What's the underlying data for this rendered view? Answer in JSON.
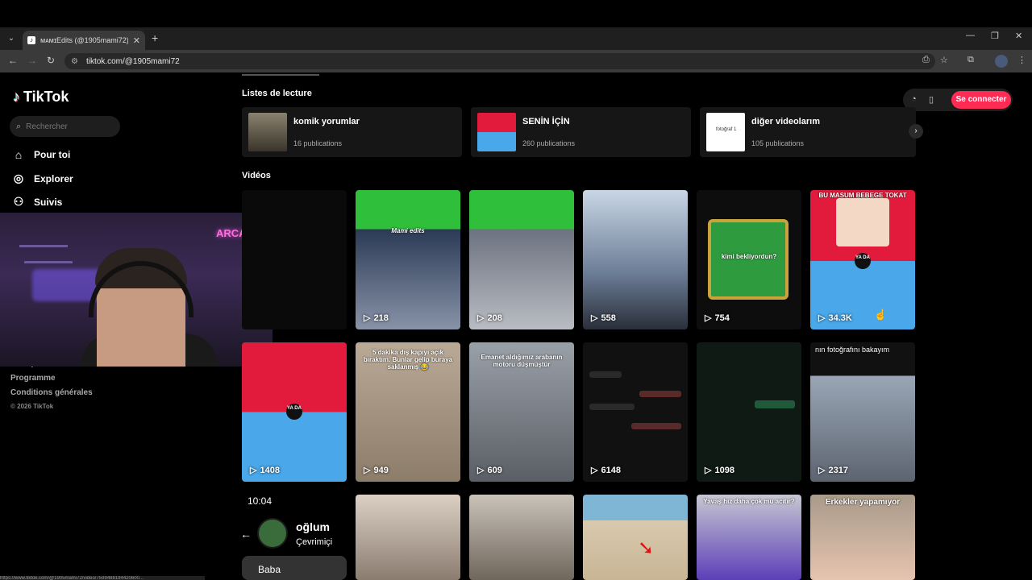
{
  "browser": {
    "tab_title": "ᴍᴀᴍɪEdits (@1905mami72) |",
    "tab_close": "✕",
    "new_tab": "+",
    "url": "tiktok.com/@1905mami72",
    "status_url": "https://www.tiktok.com/@1905mami72/video/7599488194420600..."
  },
  "sidebar": {
    "logo": "TikTok",
    "search_placeholder": "Rechercher",
    "nav": [
      {
        "label": "Pour toi",
        "icon": "compass-icon"
      },
      {
        "label": "Explorer",
        "icon": "explore-icon"
      },
      {
        "label": "Suivis",
        "icon": "following-icon"
      }
    ],
    "footer_links": [
      "Entreprise",
      "Programme",
      "Conditions générales"
    ],
    "copyright": "© 2026 TikTok"
  },
  "webcam": {
    "neon_sign": "ARCADE"
  },
  "header": {
    "connect_label": "Se connecter"
  },
  "playlists": {
    "title": "Listes de lecture",
    "items": [
      {
        "name": "komik yorumlar",
        "count": "16 publications"
      },
      {
        "name": "SENİN İÇİN",
        "count": "260 publications"
      },
      {
        "name": "diğer videolarım",
        "count": "105 publications",
        "thumb_text": "fotoğraf 1"
      }
    ]
  },
  "videos": {
    "title": "Vidéos",
    "row1": [
      {
        "views": "",
        "caption": ""
      },
      {
        "views": "218",
        "caption": "Mami edits"
      },
      {
        "views": "208",
        "caption": ""
      },
      {
        "views": "558",
        "caption": ""
      },
      {
        "views": "754",
        "caption": "kimi bekliyordun?"
      },
      {
        "views": "34.3K",
        "caption": "BU MASUM BEBEGE TOKAT AT",
        "badge": "YA DA"
      }
    ],
    "row2": [
      {
        "views": "1408",
        "caption": "",
        "badge": "YA DA"
      },
      {
        "views": "949",
        "caption": "5 dakika dış kapıyı açık bıraktım. Bunlar gelip buraya saklanmış 😂"
      },
      {
        "views": "609",
        "caption": "Emanet aldığımız arabanın motoru düşmüştür"
      },
      {
        "views": "6148",
        "caption": ""
      },
      {
        "views": "1098",
        "caption": ""
      },
      {
        "views": "2317",
        "caption": "nın fotoğrafını bakayım"
      }
    ],
    "row3": [
      {
        "caption": ""
      },
      {
        "caption": ""
      },
      {
        "caption": ""
      },
      {
        "caption": "Yavaş hız daha çok mu acıtır?"
      },
      {
        "caption": "Erkekler yapamıyor"
      }
    ]
  },
  "chat": {
    "time": "10:04",
    "name": "oğlum",
    "status": "Çevrimiçi",
    "bubble": "Baba"
  },
  "colors": {
    "accent": "#fe2c55",
    "bg": "#000000",
    "card": "#161616"
  }
}
